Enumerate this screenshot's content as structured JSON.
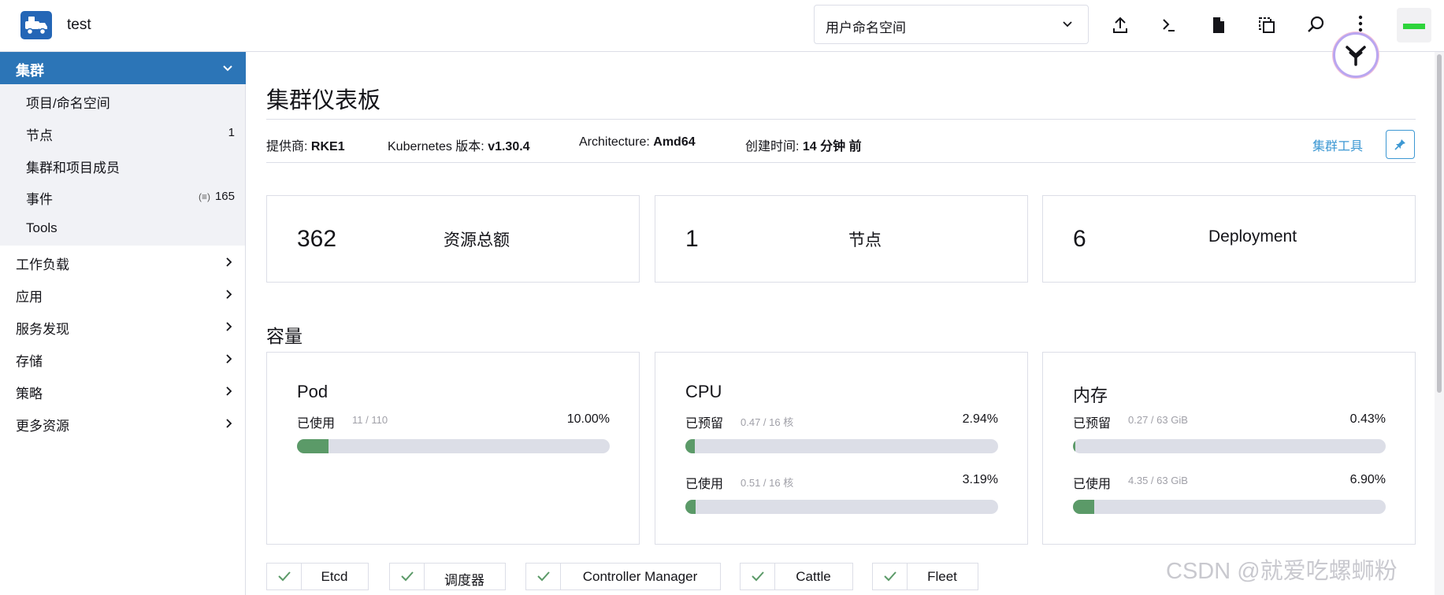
{
  "header": {
    "cluster_name": "test",
    "namespace_select": "用户命名空间",
    "icons": [
      "logo-icon",
      "upload-icon",
      "terminal-icon",
      "file-icon",
      "copy-kubeconfig-icon",
      "search-icon",
      "more-vertical-icon"
    ],
    "user_status_color": "#2ed43b"
  },
  "sidebar": {
    "active_group": "集群",
    "sub_items": [
      {
        "label": "项目/命名空间",
        "count": ""
      },
      {
        "label": "节点",
        "count": "1"
      },
      {
        "label": "集群和项目成员",
        "count": ""
      },
      {
        "label": "事件",
        "count": "165",
        "badge": "(≡)"
      },
      {
        "label": "Tools",
        "count": ""
      }
    ],
    "groups": [
      "工作负载",
      "应用",
      "服务发现",
      "存储",
      "策略",
      "更多资源"
    ]
  },
  "main": {
    "title": "集群仪表板",
    "meta": {
      "provider_label": "提供商:",
      "provider_value": "RKE1",
      "k8s_label": "Kubernetes 版本:",
      "k8s_value": "v1.30.4",
      "arch_label": "Architecture:",
      "arch_value": "Amd64",
      "created_label": "创建时间:",
      "created_value": "14 分钟 前"
    },
    "tools_link": "集群工具",
    "counts": [
      {
        "value": "362",
        "label": "资源总额"
      },
      {
        "value": "1",
        "label": "节点"
      },
      {
        "value": "6",
        "label": "Deployment"
      }
    ],
    "capacity_title": "容量",
    "capacity": [
      {
        "title": "Pod",
        "gauges": [
          {
            "label": "已使用",
            "detail": "11 / 110",
            "percent": "10.00%",
            "fraction": 0.1
          }
        ]
      },
      {
        "title": "CPU",
        "gauges": [
          {
            "label": "已预留",
            "detail": "0.47 / 16 核",
            "percent": "2.94%",
            "fraction": 0.0294
          },
          {
            "label": "已使用",
            "detail": "0.51 / 16 核",
            "percent": "3.19%",
            "fraction": 0.0319
          }
        ]
      },
      {
        "title": "内存",
        "gauges": [
          {
            "label": "已预留",
            "detail": "0.27 / 63 GiB",
            "percent": "0.43%",
            "fraction": 0.0043
          },
          {
            "label": "已使用",
            "detail": "4.35 / 63 GiB",
            "percent": "6.90%",
            "fraction": 0.069
          }
        ]
      }
    ],
    "components": [
      "Etcd",
      "调度器",
      "Controller Manager",
      "Cattle",
      "Fleet"
    ],
    "gauge_color": "#5b9a68",
    "accent_color": "#2c75b7"
  },
  "watermark": "CSDN @就爱吃螺蛳粉"
}
